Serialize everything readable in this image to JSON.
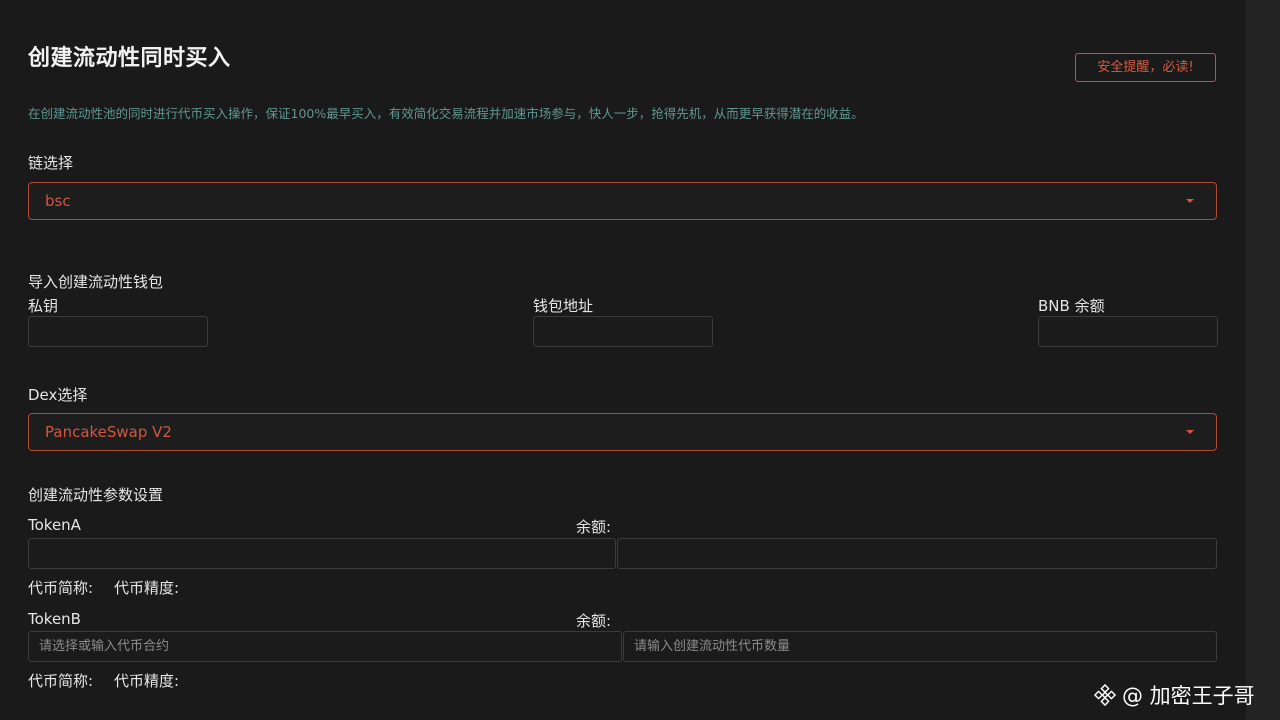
{
  "header": {
    "title": "创建流动性同时买入",
    "warn_button": "安全提醒，必读!",
    "subtitle": "在创建流动性池的同时进行代币买入操作，保证100%最早买入，有效简化交易流程并加速市场参与，快人一步，抢得先机，从而更早获得潜在的收益。"
  },
  "chain": {
    "label": "链选择",
    "value": "bsc"
  },
  "wallet": {
    "section_label": "导入创建流动性钱包",
    "private_key_label": "私钥",
    "address_label": "钱包地址",
    "balance_label": "BNB 余额",
    "private_key_value": "",
    "address_value": "",
    "balance_value": ""
  },
  "dex": {
    "label": "Dex选择",
    "value": "PancakeSwap V2"
  },
  "params": {
    "section_label": "创建流动性参数设置",
    "tokenA": {
      "label": "TokenA",
      "balance_label": "余额:",
      "symbol_label": "代币简称:",
      "decimals_label": "代币精度:",
      "address_placeholder": "",
      "amount_placeholder": ""
    },
    "tokenB": {
      "label": "TokenB",
      "balance_label": "余额:",
      "symbol_label": "代币简称:",
      "decimals_label": "代币精度:",
      "address_placeholder": "请选择或输入代币合约",
      "amount_placeholder": "请输入创建流动性代币数量"
    }
  },
  "watermark": {
    "text": "@ 加密王子哥",
    "icon": "binance-logo-icon"
  },
  "colors": {
    "background": "#1a1a1a",
    "accent": "#d25640",
    "subtitle": "#5f9791"
  }
}
